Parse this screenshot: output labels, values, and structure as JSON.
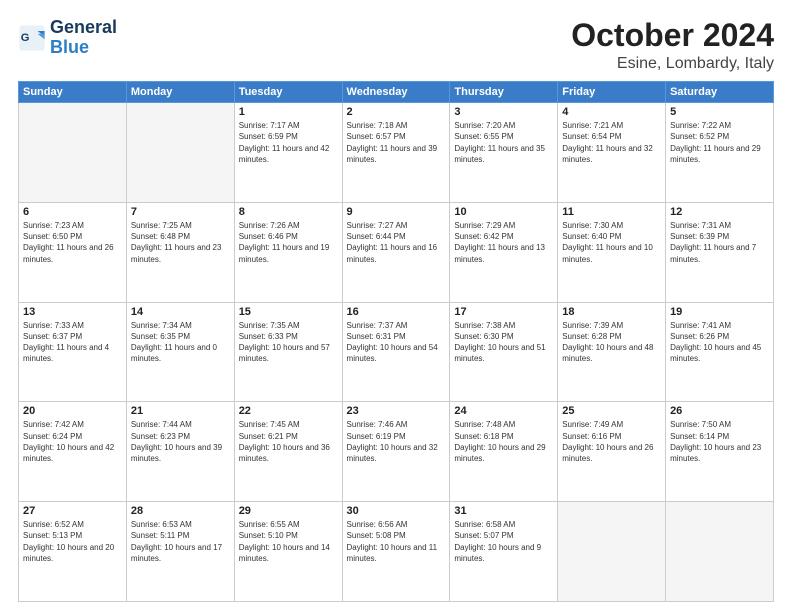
{
  "header": {
    "logo_line1": "General",
    "logo_line2": "Blue",
    "month": "October 2024",
    "location": "Esine, Lombardy, Italy"
  },
  "weekdays": [
    "Sunday",
    "Monday",
    "Tuesday",
    "Wednesday",
    "Thursday",
    "Friday",
    "Saturday"
  ],
  "weeks": [
    [
      {
        "day": "",
        "sunrise": "",
        "sunset": "",
        "daylight": ""
      },
      {
        "day": "",
        "sunrise": "",
        "sunset": "",
        "daylight": ""
      },
      {
        "day": "1",
        "sunrise": "Sunrise: 7:17 AM",
        "sunset": "Sunset: 6:59 PM",
        "daylight": "Daylight: 11 hours and 42 minutes."
      },
      {
        "day": "2",
        "sunrise": "Sunrise: 7:18 AM",
        "sunset": "Sunset: 6:57 PM",
        "daylight": "Daylight: 11 hours and 39 minutes."
      },
      {
        "day": "3",
        "sunrise": "Sunrise: 7:20 AM",
        "sunset": "Sunset: 6:55 PM",
        "daylight": "Daylight: 11 hours and 35 minutes."
      },
      {
        "day": "4",
        "sunrise": "Sunrise: 7:21 AM",
        "sunset": "Sunset: 6:54 PM",
        "daylight": "Daylight: 11 hours and 32 minutes."
      },
      {
        "day": "5",
        "sunrise": "Sunrise: 7:22 AM",
        "sunset": "Sunset: 6:52 PM",
        "daylight": "Daylight: 11 hours and 29 minutes."
      }
    ],
    [
      {
        "day": "6",
        "sunrise": "Sunrise: 7:23 AM",
        "sunset": "Sunset: 6:50 PM",
        "daylight": "Daylight: 11 hours and 26 minutes."
      },
      {
        "day": "7",
        "sunrise": "Sunrise: 7:25 AM",
        "sunset": "Sunset: 6:48 PM",
        "daylight": "Daylight: 11 hours and 23 minutes."
      },
      {
        "day": "8",
        "sunrise": "Sunrise: 7:26 AM",
        "sunset": "Sunset: 6:46 PM",
        "daylight": "Daylight: 11 hours and 19 minutes."
      },
      {
        "day": "9",
        "sunrise": "Sunrise: 7:27 AM",
        "sunset": "Sunset: 6:44 PM",
        "daylight": "Daylight: 11 hours and 16 minutes."
      },
      {
        "day": "10",
        "sunrise": "Sunrise: 7:29 AM",
        "sunset": "Sunset: 6:42 PM",
        "daylight": "Daylight: 11 hours and 13 minutes."
      },
      {
        "day": "11",
        "sunrise": "Sunrise: 7:30 AM",
        "sunset": "Sunset: 6:40 PM",
        "daylight": "Daylight: 11 hours and 10 minutes."
      },
      {
        "day": "12",
        "sunrise": "Sunrise: 7:31 AM",
        "sunset": "Sunset: 6:39 PM",
        "daylight": "Daylight: 11 hours and 7 minutes."
      }
    ],
    [
      {
        "day": "13",
        "sunrise": "Sunrise: 7:33 AM",
        "sunset": "Sunset: 6:37 PM",
        "daylight": "Daylight: 11 hours and 4 minutes."
      },
      {
        "day": "14",
        "sunrise": "Sunrise: 7:34 AM",
        "sunset": "Sunset: 6:35 PM",
        "daylight": "Daylight: 11 hours and 0 minutes."
      },
      {
        "day": "15",
        "sunrise": "Sunrise: 7:35 AM",
        "sunset": "Sunset: 6:33 PM",
        "daylight": "Daylight: 10 hours and 57 minutes."
      },
      {
        "day": "16",
        "sunrise": "Sunrise: 7:37 AM",
        "sunset": "Sunset: 6:31 PM",
        "daylight": "Daylight: 10 hours and 54 minutes."
      },
      {
        "day": "17",
        "sunrise": "Sunrise: 7:38 AM",
        "sunset": "Sunset: 6:30 PM",
        "daylight": "Daylight: 10 hours and 51 minutes."
      },
      {
        "day": "18",
        "sunrise": "Sunrise: 7:39 AM",
        "sunset": "Sunset: 6:28 PM",
        "daylight": "Daylight: 10 hours and 48 minutes."
      },
      {
        "day": "19",
        "sunrise": "Sunrise: 7:41 AM",
        "sunset": "Sunset: 6:26 PM",
        "daylight": "Daylight: 10 hours and 45 minutes."
      }
    ],
    [
      {
        "day": "20",
        "sunrise": "Sunrise: 7:42 AM",
        "sunset": "Sunset: 6:24 PM",
        "daylight": "Daylight: 10 hours and 42 minutes."
      },
      {
        "day": "21",
        "sunrise": "Sunrise: 7:44 AM",
        "sunset": "Sunset: 6:23 PM",
        "daylight": "Daylight: 10 hours and 39 minutes."
      },
      {
        "day": "22",
        "sunrise": "Sunrise: 7:45 AM",
        "sunset": "Sunset: 6:21 PM",
        "daylight": "Daylight: 10 hours and 36 minutes."
      },
      {
        "day": "23",
        "sunrise": "Sunrise: 7:46 AM",
        "sunset": "Sunset: 6:19 PM",
        "daylight": "Daylight: 10 hours and 32 minutes."
      },
      {
        "day": "24",
        "sunrise": "Sunrise: 7:48 AM",
        "sunset": "Sunset: 6:18 PM",
        "daylight": "Daylight: 10 hours and 29 minutes."
      },
      {
        "day": "25",
        "sunrise": "Sunrise: 7:49 AM",
        "sunset": "Sunset: 6:16 PM",
        "daylight": "Daylight: 10 hours and 26 minutes."
      },
      {
        "day": "26",
        "sunrise": "Sunrise: 7:50 AM",
        "sunset": "Sunset: 6:14 PM",
        "daylight": "Daylight: 10 hours and 23 minutes."
      }
    ],
    [
      {
        "day": "27",
        "sunrise": "Sunrise: 6:52 AM",
        "sunset": "Sunset: 5:13 PM",
        "daylight": "Daylight: 10 hours and 20 minutes."
      },
      {
        "day": "28",
        "sunrise": "Sunrise: 6:53 AM",
        "sunset": "Sunset: 5:11 PM",
        "daylight": "Daylight: 10 hours and 17 minutes."
      },
      {
        "day": "29",
        "sunrise": "Sunrise: 6:55 AM",
        "sunset": "Sunset: 5:10 PM",
        "daylight": "Daylight: 10 hours and 14 minutes."
      },
      {
        "day": "30",
        "sunrise": "Sunrise: 6:56 AM",
        "sunset": "Sunset: 5:08 PM",
        "daylight": "Daylight: 10 hours and 11 minutes."
      },
      {
        "day": "31",
        "sunrise": "Sunrise: 6:58 AM",
        "sunset": "Sunset: 5:07 PM",
        "daylight": "Daylight: 10 hours and 9 minutes."
      },
      {
        "day": "",
        "sunrise": "",
        "sunset": "",
        "daylight": ""
      },
      {
        "day": "",
        "sunrise": "",
        "sunset": "",
        "daylight": ""
      }
    ]
  ]
}
